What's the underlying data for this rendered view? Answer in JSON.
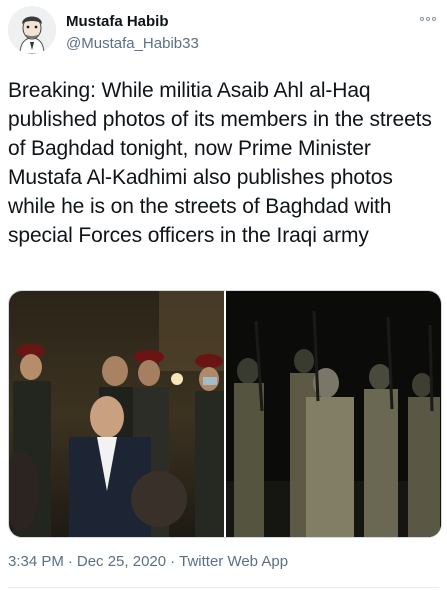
{
  "user": {
    "name": "Mustafa Habib",
    "handle": "@Mustafa_Habib33"
  },
  "tweet": {
    "text": "Breaking: While militia Asaib Ahl al-Haq published photos of its members in the streets of Baghdad tonight, now Prime Minister Mustafa Al-Kadhimi also publishes photos while he is on the streets of Baghdad with special Forces officers in the Iraqi army"
  },
  "meta": {
    "time": "3:34 PM",
    "separator": "·",
    "date": "Dec 25, 2020",
    "source": "Twitter Web App"
  },
  "icons": {
    "more": "more-options-icon",
    "avatar": "avatar-cartoon"
  },
  "colors": {
    "text": "#0f1419",
    "secondary": "#5b7083",
    "border": "#cfd9de"
  }
}
